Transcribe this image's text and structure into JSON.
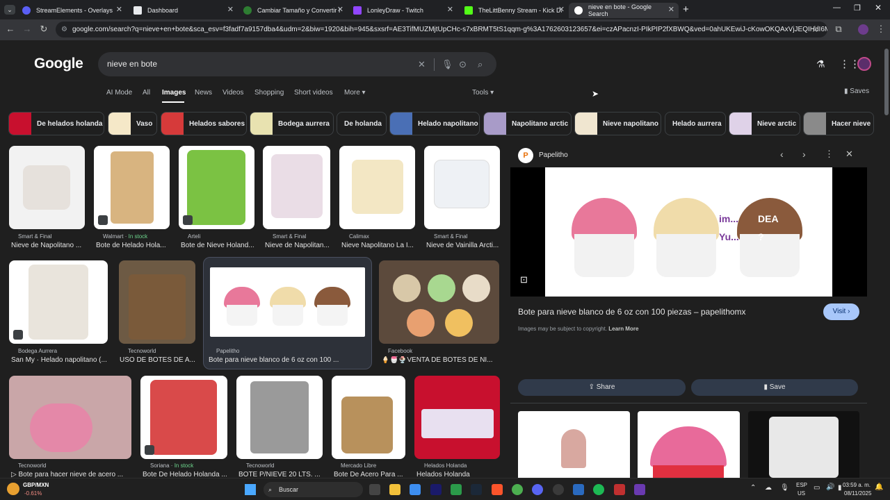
{
  "tabs": [
    {
      "label": "StreamElements - Overlays",
      "color": "#5a5ff5"
    },
    {
      "label": "Dashboard",
      "color": "#ffffff"
    },
    {
      "label": "Cambiar Tamaño y Convertir Im",
      "color": "#2e7d32"
    },
    {
      "label": "LonleyDraw - Twitch",
      "color": "#9146ff"
    },
    {
      "label": "TheLittBenny Stream - Kick Das",
      "color": "#53fc18"
    },
    {
      "label": "nieve en bote - Google Search",
      "color": "#ffffff"
    }
  ],
  "url": "google.com/search?q=nieve+en+bote&sca_esv=f3fadf7a9157dba4&udm=2&biw=1920&bih=945&sxsrf=AE3TifMUZMjtUpCHc-s7xBRMT5tS1qqm-g%3A1762603123657&ei=czAPacnzI-PIkPIP2fXBWQ&ved=0ahUKEwiJ-cKowOKQAxVjJEQIHdI6MAsQ4dUD...",
  "google": {
    "logo": "Google",
    "query": "nieve en bote",
    "saves": "Saves"
  },
  "nav_tabs": [
    "AI Mode",
    "All",
    "Images",
    "News",
    "Videos",
    "Shopping",
    "Short videos",
    "More ▾",
    "Tools ▾"
  ],
  "chips": [
    {
      "label": "De helados holanda",
      "color": "#c8102e"
    },
    {
      "label": "Vaso",
      "color": "#f5e8c8"
    },
    {
      "label": "Helados sabores",
      "color": "#d63a3a"
    },
    {
      "label": "Bodega aurrera",
      "color": "#e8e2b0"
    },
    {
      "label": "De holanda",
      "color": ""
    },
    {
      "label": "Helado napolitano",
      "color": "#4a6fb5"
    },
    {
      "label": "Napolitano arctic",
      "color": "#a89bc8"
    },
    {
      "label": "Nieve napolitano",
      "color": "#f0e6d0"
    },
    {
      "label": "Helado aurrera",
      "color": ""
    },
    {
      "label": "Nieve arctic",
      "color": "#dfd2e8"
    },
    {
      "label": "Hacer nieve",
      "color": "#8a8a8a"
    }
  ],
  "results": [
    {
      "src": "Smart & Final",
      "title": "Nieve de Napolitano ...",
      "stock": "",
      "color": "#e6e1dc"
    },
    {
      "src": "Walmart",
      "title": "Bote de Helado Hola...",
      "stock": "In stock",
      "color": "#d8b480"
    },
    {
      "src": "Arteli",
      "title": "Bote de Nieve Holand...",
      "stock": "",
      "color": "#7bc243"
    },
    {
      "src": "Smart & Final",
      "title": "Nieve de Napolitan...",
      "stock": "",
      "color": "#eadde6"
    },
    {
      "src": "Calimax",
      "title": "Nieve Napolitano La I...",
      "stock": "",
      "color": "#f3e7c4"
    },
    {
      "src": "Smart & Final",
      "title": "Nieve de Vainilla Arcti...",
      "stock": "",
      "color": "#eef1f5"
    },
    {
      "src": "Bodega Aurrera",
      "title": "San My · Helado napolitano (...",
      "stock": "",
      "color": "#e9e4dc"
    },
    {
      "src": "Tecnoworld",
      "title": "USO DE BOTES DE A...",
      "stock": "",
      "color": "#7a5a3a"
    },
    {
      "src": "Papelitho",
      "title": "Bote para nieve blanco de 6 oz con 100 ...",
      "stock": "",
      "color": "#ffffff"
    },
    {
      "src": "Facebook",
      "title": "🍦🍧🍨VENTA DE BOTES DE NI...",
      "stock": "",
      "color": "#5c4a3c"
    },
    {
      "src": "Tecnoworld",
      "title": "▷ Bote para hacer nieve de acero ...",
      "stock": "",
      "color": "#c9a6a8"
    },
    {
      "src": "Soriana",
      "title": "Bote De Helado Holanda ...",
      "stock": "In stock",
      "color": "#d94a4a"
    },
    {
      "src": "Tecnoworld",
      "title": "BOTE P/NIEVE 20 LTS. ...",
      "stock": "",
      "color": "#9a9a9a"
    },
    {
      "src": "Mercado Libre",
      "title": "Bote De Acero Para ...",
      "stock": "",
      "color": "#b8915c"
    },
    {
      "src": "Helados Holanda",
      "title": "Helados Holanda",
      "stock": "",
      "color": "#c8102e"
    }
  ],
  "panel": {
    "site": "Papelitho",
    "title": "Bote para nieve blanco de 6 oz con 100 piezas – papelithomx",
    "visit": "Visit ›",
    "copyright": "Images may be subject to copyright.",
    "learn": "Learn More",
    "share": "Share",
    "save": "Save",
    "overlay_text": [
      "im...",
      "DEA",
      "Yu...",
      "?"
    ]
  },
  "taskbar": {
    "ticker": "GBP/MXN",
    "change": "-0.61%",
    "search": "Buscar",
    "lang1": "ESP",
    "lang2": "US",
    "time": "03:59 a. m.",
    "date": "08/11/2025"
  }
}
